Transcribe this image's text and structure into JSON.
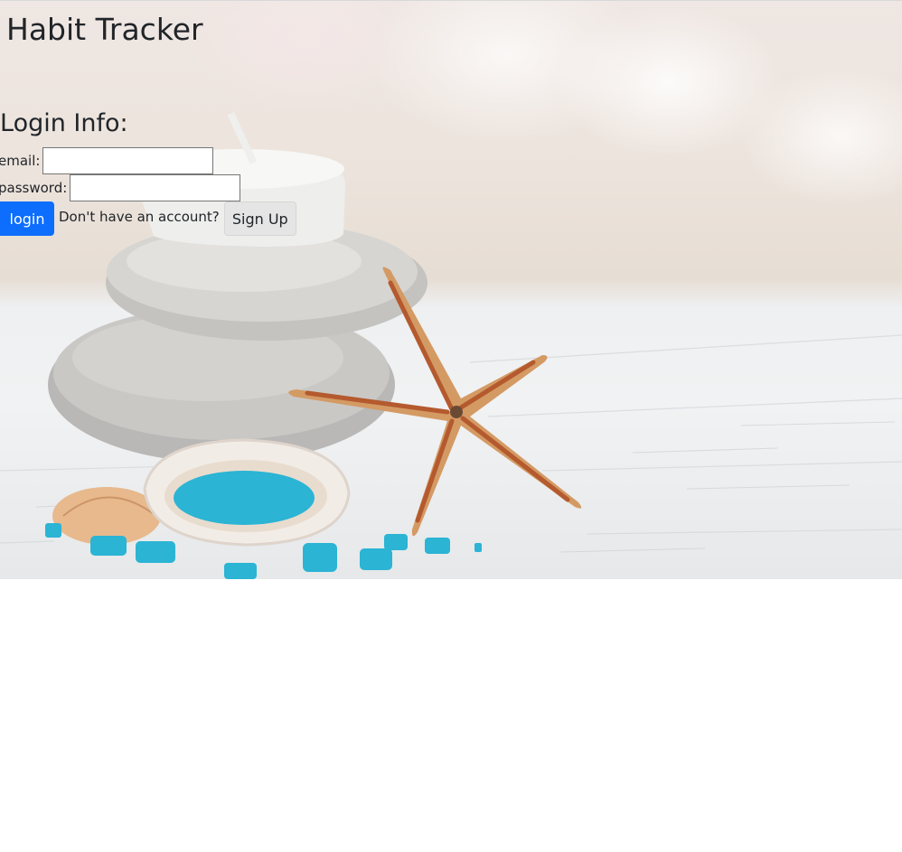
{
  "header": {
    "title": "Habit Tracker"
  },
  "login": {
    "heading": "Login Info:",
    "email_label": "email:",
    "email_value": "",
    "password_label": "password:",
    "password_value": "",
    "login_button": "login",
    "signup_prompt": "Don't have an account?",
    "signup_button": "Sign Up"
  },
  "colors": {
    "primary_button": "#0d6efd",
    "secondary_button": "#e5e5e5",
    "text": "#212529"
  },
  "background": {
    "icons": [
      "candle-icon",
      "stone-stack-icon",
      "starfish-icon",
      "seashell-icon",
      "bath-salt-icon"
    ]
  }
}
